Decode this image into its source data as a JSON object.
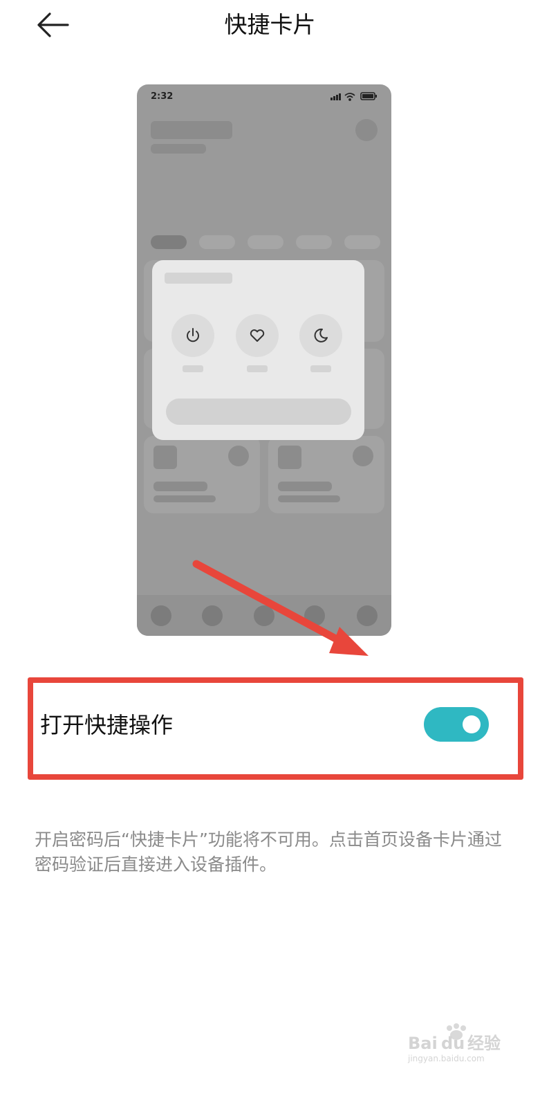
{
  "header": {
    "title": "快捷卡片"
  },
  "preview": {
    "status_time": "2:32",
    "quick_actions": [
      {
        "icon": "power-icon"
      },
      {
        "icon": "heart-icon"
      },
      {
        "icon": "moon-icon"
      }
    ]
  },
  "setting": {
    "label": "打开快捷操作",
    "enabled": true,
    "toggle_color": "#2fb8c2"
  },
  "description": "开启密码后“快捷卡片”功能将不可用。点击首页设备卡片通过密码验证后直接进入设备插件。",
  "annotation": {
    "color": "#e8463b"
  },
  "watermark": {
    "brand": "Baidu经验",
    "url": "jingyan.baidu.com"
  }
}
